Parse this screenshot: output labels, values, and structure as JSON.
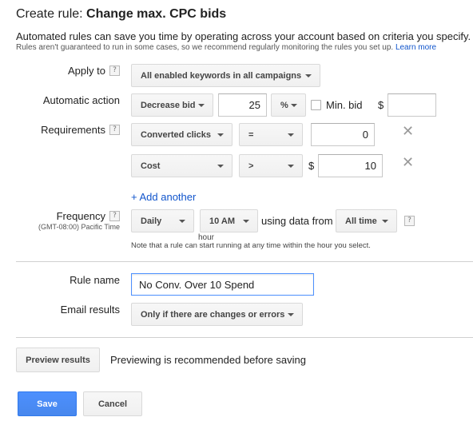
{
  "header": {
    "title_prefix": "Create rule:",
    "title_name": "Change max. CPC bids",
    "intro": "Automated rules can save you time by operating across your account based on criteria you specify.",
    "note": "Rules aren't guaranteed to run in some cases, so we recommend regularly monitoring the rules you set up.",
    "learn_more": "Learn more"
  },
  "apply_to": {
    "label": "Apply to",
    "value": "All enabled keywords in all campaigns"
  },
  "automatic_action": {
    "label": "Automatic action",
    "action": "Decrease bid",
    "amount": "25",
    "unit": "%",
    "min_bid_label": "Min. bid",
    "min_bid_checked": false,
    "currency": "$",
    "min_bid_value": ""
  },
  "requirements": {
    "label": "Requirements",
    "rows": [
      {
        "metric": "Converted clicks",
        "operator": "=",
        "currency": "",
        "value": "0"
      },
      {
        "metric": "Cost",
        "operator": ">",
        "currency": "$",
        "value": "10"
      }
    ],
    "add_another": "+ Add another"
  },
  "frequency": {
    "label": "Frequency",
    "timezone": "(GMT-08:00) Pacific Time",
    "period": "Daily",
    "time": "10 AM",
    "time_caption": "hour",
    "using_data_from": "using data from",
    "data_range": "All time",
    "note": "Note that a rule can start running at any time within the hour you select."
  },
  "rule_name": {
    "label": "Rule name",
    "value": "No Conv. Over 10 Spend"
  },
  "email_results": {
    "label": "Email results",
    "value": "Only if there are changes or errors"
  },
  "preview": {
    "button": "Preview results",
    "message": "Previewing is recommended before saving"
  },
  "footer": {
    "save": "Save",
    "cancel": "Cancel"
  },
  "colors": {
    "link": "#1155cc",
    "primary_button": "#4d90fe"
  }
}
